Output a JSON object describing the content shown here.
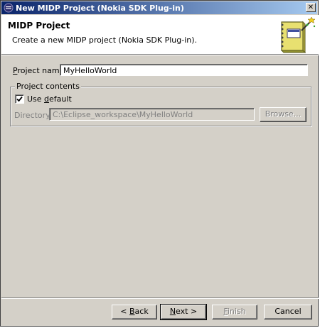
{
  "window": {
    "title": "New MIDP Project (Nokia SDK Plug-in)",
    "close_glyph": "✕"
  },
  "banner": {
    "title": "MIDP Project",
    "description": "Create a new MIDP project (Nokia SDK Plug-in).",
    "icon": "wizard-notebook-icon"
  },
  "form": {
    "project_name_label_prefix": "",
    "project_name_label_mnemonic": "P",
    "project_name_label_rest": "roject name:",
    "project_name_value": "MyHelloWorld",
    "group_title": "Project contents",
    "use_default_checked": true,
    "use_default_label_prefix": "Use ",
    "use_default_label_mnemonic": "d",
    "use_default_label_rest": "efault",
    "directory_label_prefix": "Director",
    "directory_label_mnemonic": "y",
    "directory_label_rest": ":",
    "directory_value": "C:\\Eclipse_workspace\\MyHelloWorld",
    "browse_label": "Browse..."
  },
  "buttons": {
    "back_prefix": "< ",
    "back_mnemonic": "B",
    "back_rest": "ack",
    "next_mnemonic": "N",
    "next_rest": "ext >",
    "finish_mnemonic": "F",
    "finish_rest": "inish",
    "cancel": "Cancel"
  },
  "colors": {
    "title_gradient_start": "#0a246a",
    "title_gradient_end": "#a6caf0",
    "face": "#d4d0c8"
  }
}
